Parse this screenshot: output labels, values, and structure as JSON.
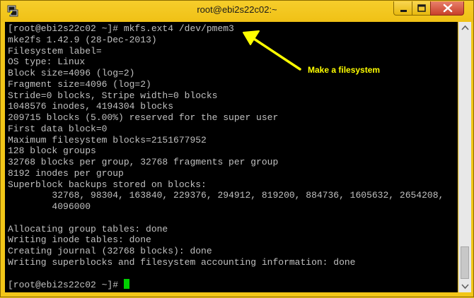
{
  "window": {
    "title": "root@ebi2s22c02:~",
    "accent_color": "#f0c419",
    "close_color": "#c8402a",
    "icons": {
      "app": "putty-terminal-icon",
      "minimize": "minimize-icon",
      "maximize": "maximize-icon",
      "close": "close-icon"
    }
  },
  "terminal": {
    "background": "#000000",
    "text_color": "#c0c0c0",
    "cursor_color": "#00d000",
    "lines": [
      "[root@ebi2s22c02 ~]# mkfs.ext4 /dev/pmem3",
      "mke2fs 1.42.9 (28-Dec-2013)",
      "Filesystem label=",
      "OS type: Linux",
      "Block size=4096 (log=2)",
      "Fragment size=4096 (log=2)",
      "Stride=0 blocks, Stripe width=0 blocks",
      "1048576 inodes, 4194304 blocks",
      "209715 blocks (5.00%) reserved for the super user",
      "First data block=0",
      "Maximum filesystem blocks=2151677952",
      "128 block groups",
      "32768 blocks per group, 32768 fragments per group",
      "8192 inodes per group",
      "Superblock backups stored on blocks:",
      "        32768, 98304, 163840, 229376, 294912, 819200, 884736, 1605632, 2654208,",
      "        4096000",
      "",
      "Allocating group tables: done",
      "Writing inode tables: done",
      "Creating journal (32768 blocks): done",
      "Writing superblocks and filesystem accounting information: done",
      ""
    ],
    "prompt": "[root@ebi2s22c02 ~]# "
  },
  "annotation": {
    "label": "Make a filesystem",
    "color": "#ffff00",
    "icon": "arrow-icon"
  }
}
